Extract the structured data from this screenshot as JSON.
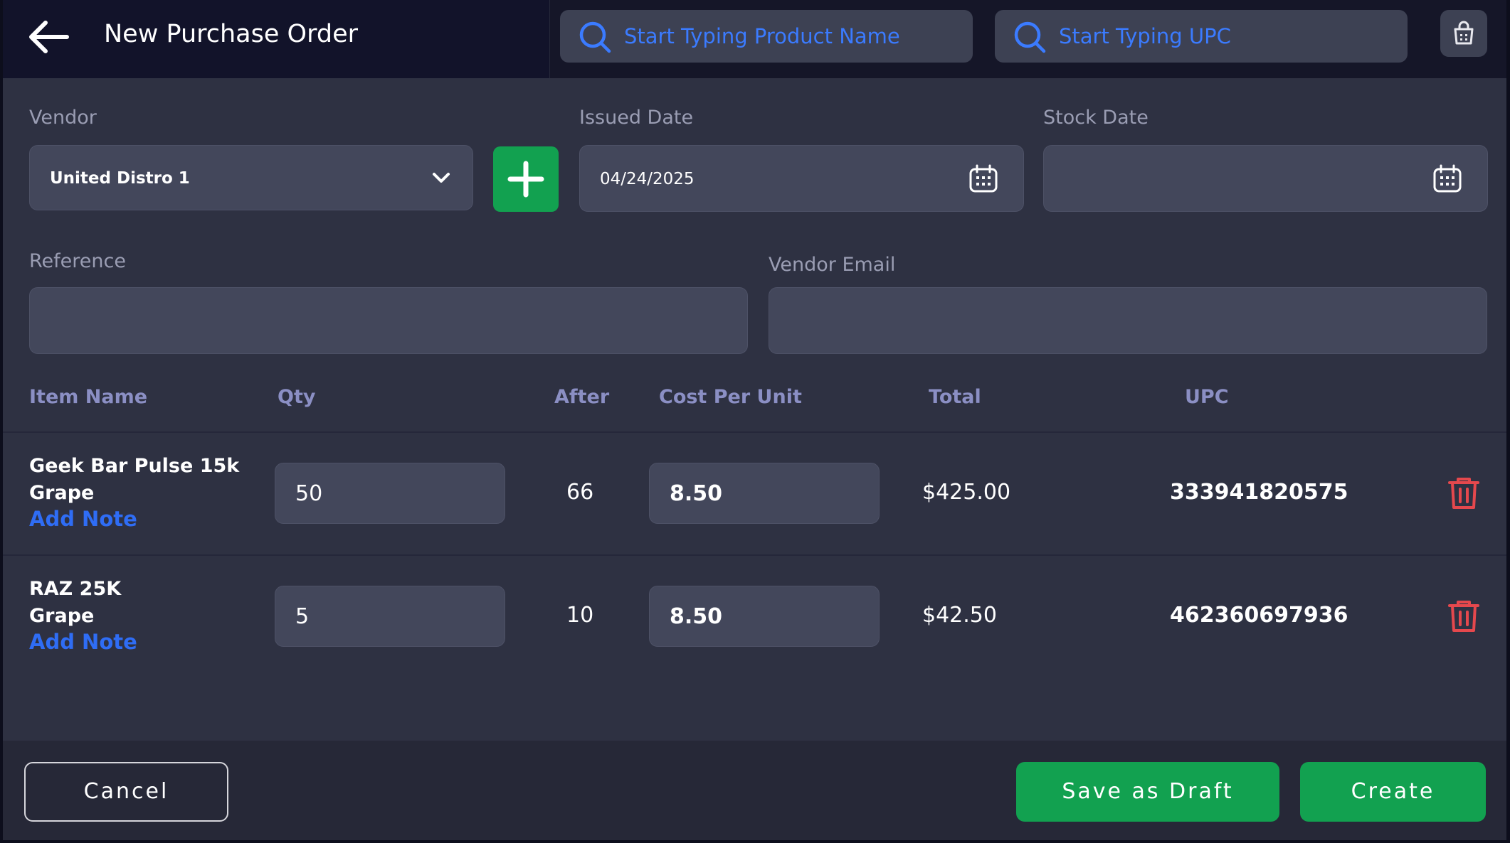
{
  "header": {
    "title": "New Purchase Order",
    "product_search_placeholder": "Start Typing Product Name",
    "upc_search_placeholder": "Start Typing UPC"
  },
  "form": {
    "vendor_label": "Vendor",
    "vendor_value": "United Distro 1",
    "issued_date_label": "Issued Date",
    "issued_date_value": "04/24/2025",
    "stock_date_label": "Stock Date",
    "stock_date_value": "",
    "reference_label": "Reference",
    "reference_value": "",
    "vendor_email_label": "Vendor Email",
    "vendor_email_value": ""
  },
  "table": {
    "columns": [
      "Item Name",
      "Qty",
      "After",
      "Cost Per Unit",
      "Total",
      "UPC"
    ],
    "rows": [
      {
        "name_line1": "Geek Bar Pulse 15k",
        "name_line2": "Grape",
        "add_note": "Add Note",
        "qty": "50",
        "after": "66",
        "cost_per_unit": "8.50",
        "total": "$425.00",
        "upc": "333941820575"
      },
      {
        "name_line1": "RAZ 25K",
        "name_line2": "Grape",
        "add_note": "Add Note",
        "qty": "5",
        "after": "10",
        "cost_per_unit": "8.50",
        "total": "$42.50",
        "upc": "462360697936"
      }
    ]
  },
  "footer": {
    "cancel_label": "Cancel",
    "save_draft_label": "Save as Draft",
    "create_label": "Create"
  },
  "colors": {
    "accent_green": "#12a150",
    "link_blue": "#2f6df5",
    "delete_red": "#e5484d",
    "background": "#2e3142"
  },
  "icons": [
    "back-arrow-icon",
    "search-icon",
    "cart-icon",
    "chevron-down-icon",
    "plus-icon",
    "calendar-icon",
    "trash-icon"
  ]
}
